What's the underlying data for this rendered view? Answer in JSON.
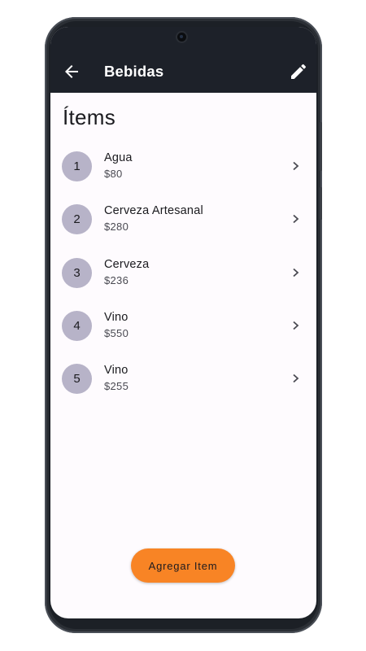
{
  "appbar": {
    "title": "Bebidas",
    "back_icon": "arrow-back-icon",
    "edit_icon": "pencil-icon"
  },
  "heading": "Ítems",
  "items": [
    {
      "index": "1",
      "name": "Agua",
      "price": "$80"
    },
    {
      "index": "2",
      "name": "Cerveza Artesanal",
      "price": "$280"
    },
    {
      "index": "3",
      "name": "Cerveza",
      "price": "$236"
    },
    {
      "index": "4",
      "name": "Vino",
      "price": "$550"
    },
    {
      "index": "5",
      "name": "Vino",
      "price": "$255"
    }
  ],
  "add_button": {
    "label": "Agregar Item"
  },
  "colors": {
    "appbar_bg": "#1d2129",
    "screen_bg": "#fefbfe",
    "avatar_bg": "#b7b3c8",
    "accent": "#f88425"
  }
}
